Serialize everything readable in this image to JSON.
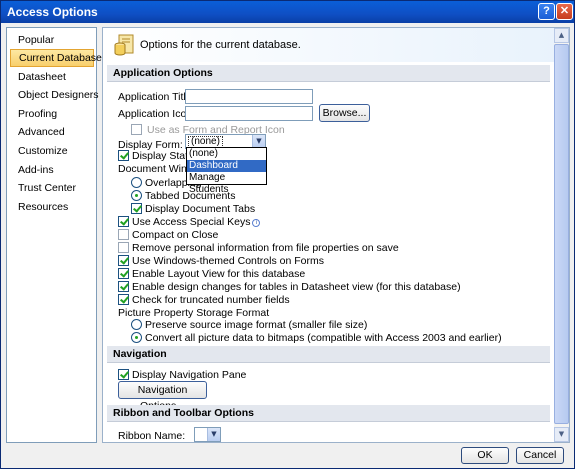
{
  "window": {
    "title": "Access Options",
    "help_glyph": "?",
    "close_glyph": "✕"
  },
  "sidebar": {
    "items": [
      {
        "label": "Popular"
      },
      {
        "label": "Current Database"
      },
      {
        "label": "Datasheet"
      },
      {
        "label": "Object Designers"
      },
      {
        "label": "Proofing"
      },
      {
        "label": "Advanced"
      },
      {
        "label": "Customize"
      },
      {
        "label": "Add-ins"
      },
      {
        "label": "Trust Center"
      },
      {
        "label": "Resources"
      }
    ],
    "selected": "Current Database"
  },
  "header": {
    "text": "Options for the current database.",
    "icon": "database-options-icon"
  },
  "sections": {
    "application_options": "Application Options",
    "navigation": "Navigation",
    "ribbon_toolbar": "Ribbon and Toolbar Options"
  },
  "app": {
    "title_label": "Application Title:",
    "title_value": "",
    "icon_label": "Application Icon:",
    "icon_value": "",
    "browse_label": "Browse...",
    "use_as_icon_label": "Use as Form and Report Icon",
    "display_form_label": "Display Form:",
    "display_form_value": "(none)",
    "display_form_options": [
      "(none)",
      "Dashboard",
      "Manage Students"
    ],
    "display_form_highlighted": "Dashboard",
    "display_status_bar_label": "Display Status B",
    "document_window_label": "Document Windo",
    "overlapping_label": "Overlapping",
    "tabbed_label": "Tabbed Documents",
    "display_tabs_label": "Display Document Tabs",
    "special_keys_label": "Use Access Special Keys",
    "compact_label": "Compact on Close",
    "remove_info_label": "Remove personal information from file properties on save",
    "themed_controls_label": "Use Windows-themed Controls on Forms",
    "layout_view_label": "Enable Layout View for this database",
    "design_changes_label": "Enable design changes for tables in Datasheet view (for this database)",
    "truncated_label": "Check for truncated number fields",
    "picture_format_label": "Picture Property Storage Format",
    "preserve_label": "Preserve source image format (smaller file size)",
    "convert_label": "Convert all picture data to bitmaps (compatible with Access 2003 and earlier)"
  },
  "nav": {
    "display_pane_label": "Display Navigation Pane",
    "options_button": "Navigation Options..."
  },
  "ribbon": {
    "name_label": "Ribbon Name:",
    "name_value": ""
  },
  "footer": {
    "ok": "OK",
    "cancel": "Cancel"
  },
  "states": {
    "use_as_icon": false,
    "display_status_bar": true,
    "tabbed_documents": true,
    "display_tabs": true,
    "special_keys": true,
    "compact": false,
    "remove_info": false,
    "themed_controls": true,
    "layout_view": true,
    "design_changes": true,
    "truncated": true,
    "preserve_format": false,
    "convert_bitmaps": true,
    "display_nav_pane": true
  }
}
